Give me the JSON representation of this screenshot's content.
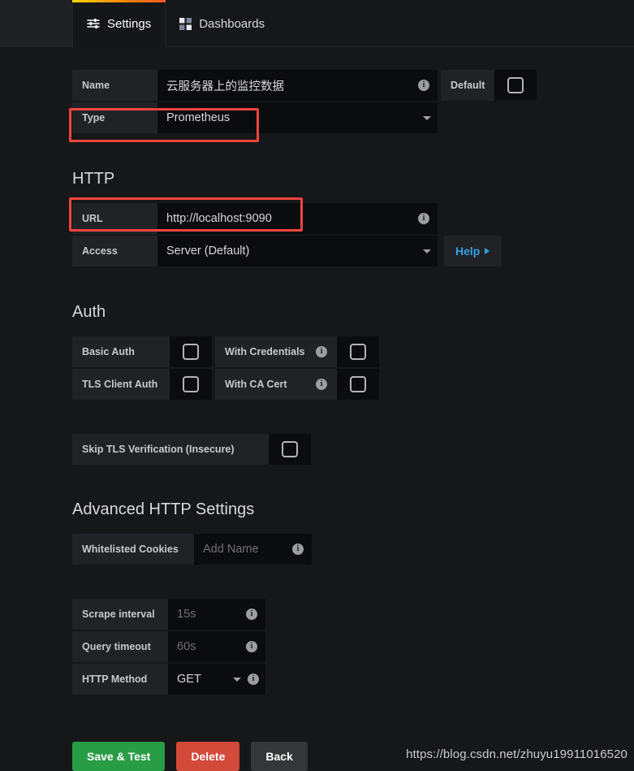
{
  "tabs": [
    {
      "label": "Settings",
      "icon": "sliders-icon",
      "active": true
    },
    {
      "label": "Dashboards",
      "icon": "grid-icon",
      "active": false
    }
  ],
  "basic": {
    "name_label": "Name",
    "name_value": "云服务器上的监控数据",
    "default_label": "Default",
    "default_checked": false,
    "type_label": "Type",
    "type_value": "Prometheus"
  },
  "http": {
    "title": "HTTP",
    "url_label": "URL",
    "url_value": "http://localhost:9090",
    "access_label": "Access",
    "access_value": "Server (Default)",
    "help_label": "Help"
  },
  "auth": {
    "title": "Auth",
    "basic_auth_label": "Basic Auth",
    "with_credentials_label": "With Credentials",
    "tls_client_auth_label": "TLS Client Auth",
    "with_ca_cert_label": "With CA Cert",
    "skip_tls_label": "Skip TLS Verification (Insecure)"
  },
  "advanced": {
    "title": "Advanced HTTP Settings",
    "cookies_label": "Whitelisted Cookies",
    "cookies_placeholder": "Add Name",
    "scrape_interval_label": "Scrape interval",
    "scrape_interval_placeholder": "15s",
    "query_timeout_label": "Query timeout",
    "query_timeout_placeholder": "60s",
    "http_method_label": "HTTP Method",
    "http_method_value": "GET"
  },
  "footer": {
    "save_label": "Save & Test",
    "delete_label": "Delete",
    "back_label": "Back",
    "watermark": "https://blog.csdn.net/zhuyu19911016520"
  },
  "colors": {
    "accent_red": "#f0443e",
    "save_green": "#299c46",
    "delete_red": "#d44a3a",
    "link_blue": "#33a2e5",
    "tab_gradient_start": "#ffd500",
    "tab_gradient_end": "#f05a28"
  }
}
